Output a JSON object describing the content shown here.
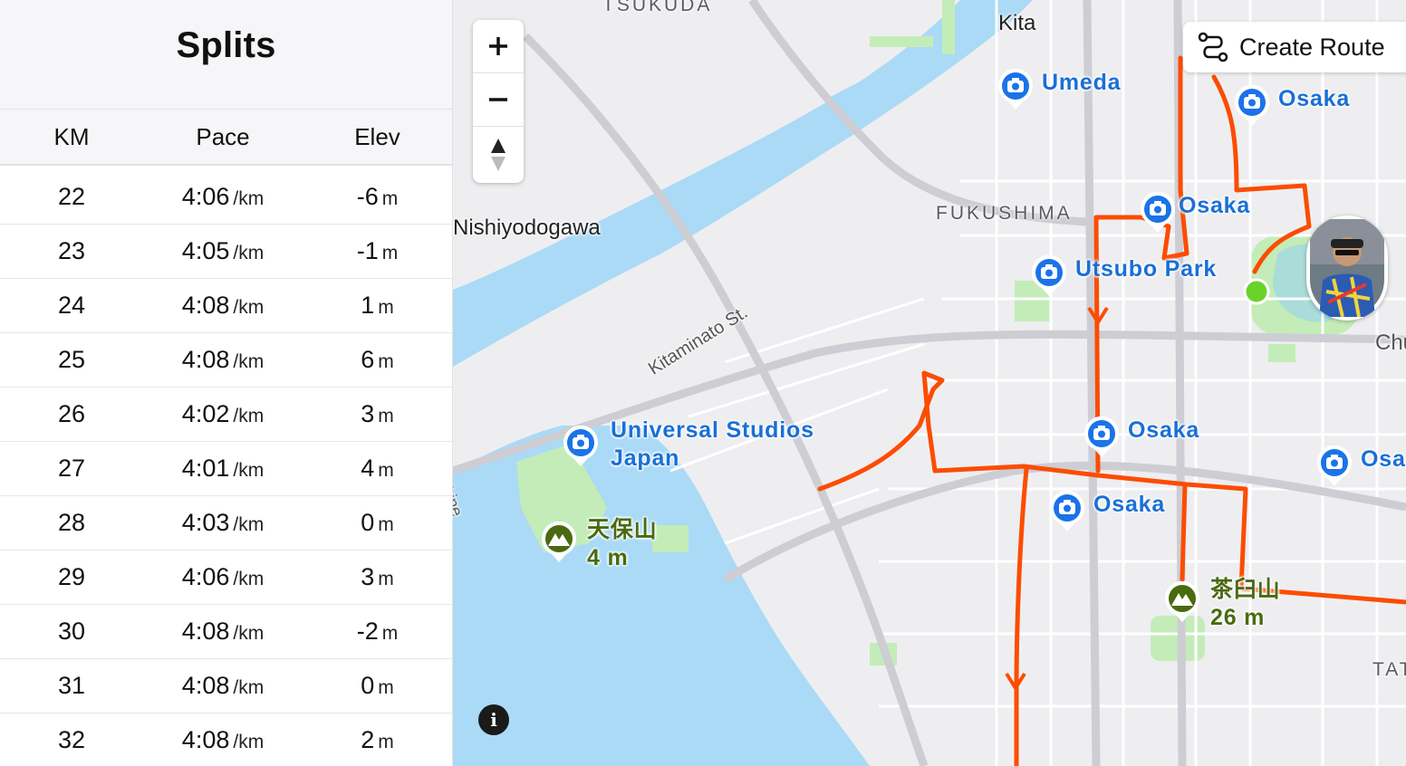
{
  "splits": {
    "title": "Splits",
    "columns": {
      "km": "KM",
      "pace": "Pace",
      "elev": "Elev"
    },
    "rows": [
      {
        "km": "22",
        "pace": "4:06",
        "pace_unit": "/km",
        "elev": "-6",
        "elev_unit": "m"
      },
      {
        "km": "23",
        "pace": "4:05",
        "pace_unit": "/km",
        "elev": "-1",
        "elev_unit": "m"
      },
      {
        "km": "24",
        "pace": "4:08",
        "pace_unit": "/km",
        "elev": "1",
        "elev_unit": "m"
      },
      {
        "km": "25",
        "pace": "4:08",
        "pace_unit": "/km",
        "elev": "6",
        "elev_unit": "m"
      },
      {
        "km": "26",
        "pace": "4:02",
        "pace_unit": "/km",
        "elev": "3",
        "elev_unit": "m"
      },
      {
        "km": "27",
        "pace": "4:01",
        "pace_unit": "/km",
        "elev": "4",
        "elev_unit": "m"
      },
      {
        "km": "28",
        "pace": "4:03",
        "pace_unit": "/km",
        "elev": "0",
        "elev_unit": "m"
      },
      {
        "km": "29",
        "pace": "4:06",
        "pace_unit": "/km",
        "elev": "3",
        "elev_unit": "m"
      },
      {
        "km": "30",
        "pace": "4:08",
        "pace_unit": "/km",
        "elev": "-2",
        "elev_unit": "m"
      },
      {
        "km": "31",
        "pace": "4:08",
        "pace_unit": "/km",
        "elev": "0",
        "elev_unit": "m"
      },
      {
        "km": "32",
        "pace": "4:08",
        "pace_unit": "/km",
        "elev": "2",
        "elev_unit": "m"
      }
    ]
  },
  "map": {
    "create_route_label": "Create Route",
    "zoom_in_icon": "plus-icon",
    "zoom_out_icon": "minus-icon",
    "compass_icon": "compass-icon",
    "info_label": "i",
    "place_labels": {
      "kita": "Kita",
      "tsukuda": "TSUKUDA",
      "fukushima": "FUKUSHIMA",
      "nishiyodogawa": "Nishiyodogawa",
      "chu": "Chu",
      "tat": "TAT",
      "line": "n Line",
      "kitaminato": "Kitaminato St."
    },
    "photo_pois": {
      "umeda": "Umeda",
      "osaka_1": "Osaka",
      "osaka_2": "Osaka",
      "utsubo": "Utsubo Park",
      "usj_1": "Universal Studios",
      "usj_2": "Japan",
      "osaka_3": "Osaka",
      "osaka_4": "Osa",
      "osaka_5": "Osaka"
    },
    "peaks": {
      "tempozan_name": "天保山",
      "tempozan_elev": "4 m",
      "chausuyama_name": "茶臼山",
      "chausuyama_elev": "26 m"
    },
    "colors": {
      "route": "#fc4c02",
      "water": "#aadaf6",
      "park": "#c4ecb8",
      "poi": "#1a73e8",
      "peak": "#4a6a10",
      "start": "#6ad32a"
    }
  }
}
